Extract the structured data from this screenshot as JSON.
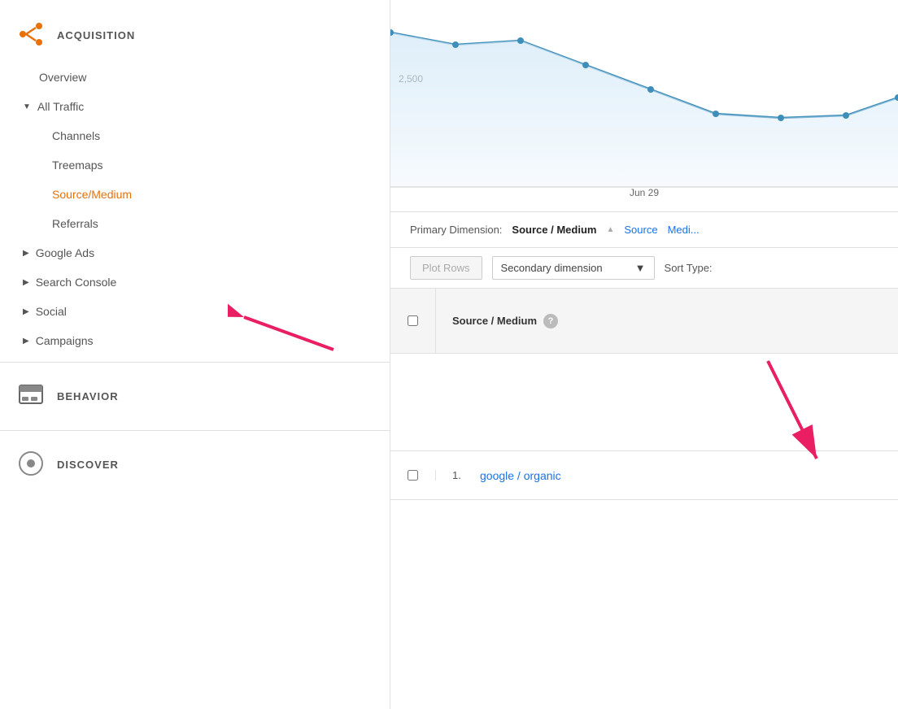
{
  "sidebar": {
    "acquisition_title": "ACQUISITION",
    "items": [
      {
        "label": "Overview",
        "type": "simple",
        "active": false,
        "indent": 2
      },
      {
        "label": "All Traffic",
        "type": "expandable",
        "expanded": true,
        "active": false,
        "indent": 1
      },
      {
        "label": "Channels",
        "type": "simple",
        "active": false,
        "indent": 3
      },
      {
        "label": "Treemaps",
        "type": "simple",
        "active": false,
        "indent": 3
      },
      {
        "label": "Source/Medium",
        "type": "simple",
        "active": true,
        "indent": 3
      },
      {
        "label": "Referrals",
        "type": "simple",
        "active": false,
        "indent": 3
      },
      {
        "label": "Google Ads",
        "type": "expandable",
        "expanded": false,
        "active": false,
        "indent": 1
      },
      {
        "label": "Search Console",
        "type": "expandable",
        "expanded": false,
        "active": false,
        "indent": 1
      },
      {
        "label": "Social",
        "type": "expandable",
        "expanded": false,
        "active": false,
        "indent": 1
      },
      {
        "label": "Campaigns",
        "type": "expandable",
        "expanded": false,
        "active": false,
        "indent": 1
      }
    ],
    "behavior_title": "BEHAVIOR",
    "discover_title": "DISCOVER"
  },
  "chart": {
    "y_label": "2,500",
    "x_label": "Jun 29"
  },
  "primary_dimension": {
    "label": "Primary Dimension:",
    "active_option": "Source / Medium",
    "link1": "Source",
    "link2": "Medi..."
  },
  "toolbar": {
    "plot_rows_label": "Plot Rows",
    "secondary_dimension_label": "Secondary dimension",
    "sort_type_label": "Sort Type:"
  },
  "table": {
    "header": {
      "col1": "Source / Medium",
      "help_icon": "?"
    },
    "rows": [
      {
        "number": "1.",
        "value": "google / organic"
      }
    ]
  },
  "colors": {
    "orange": "#e8710a",
    "blue_link": "#1a73e8",
    "pink_arrow": "#e91e63",
    "chart_line": "#3d8eb9",
    "chart_fill": "#d6eaf8"
  }
}
